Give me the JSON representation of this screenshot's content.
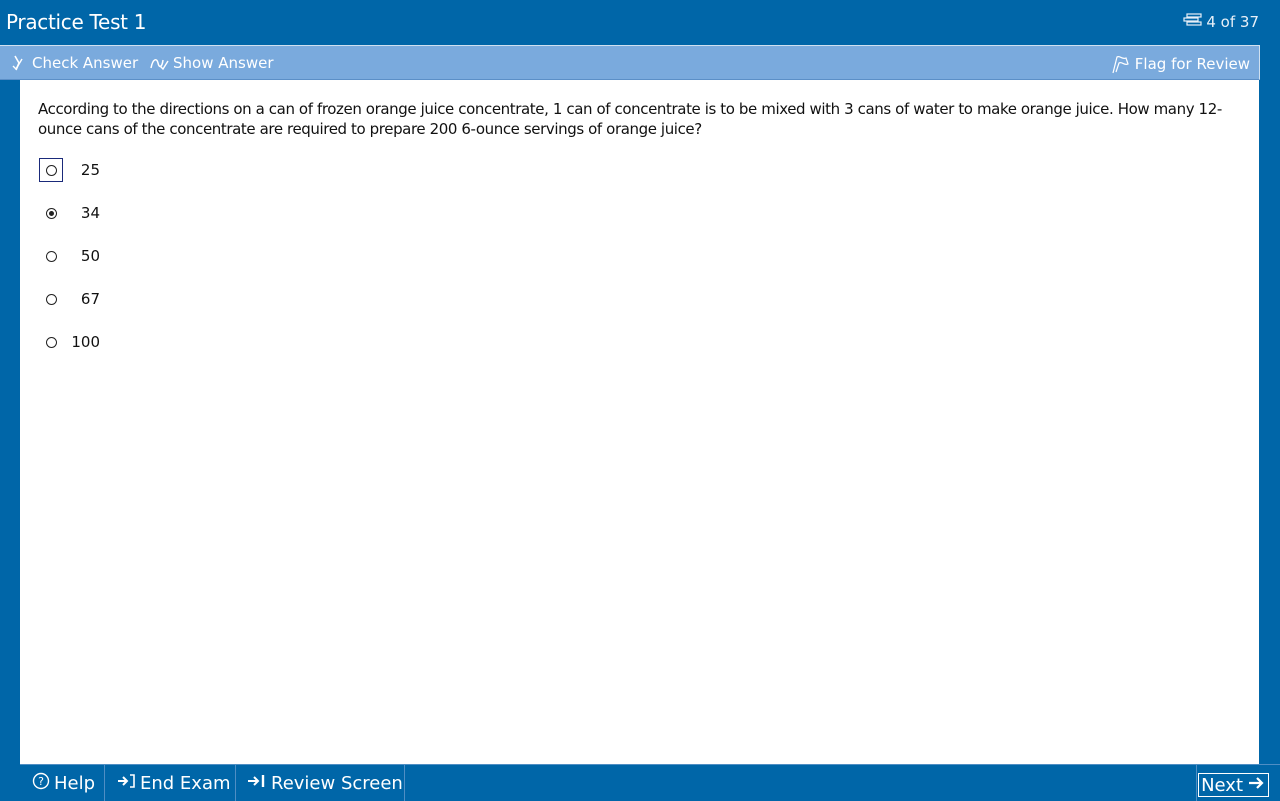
{
  "header": {
    "title": "Practice Test 1",
    "progress": "4 of 37"
  },
  "toolbar": {
    "check_answer": "Check Answer",
    "show_answer": "Show Answer",
    "flag_for_review": "Flag for Review"
  },
  "question": {
    "text": "According to the directions on a can of frozen orange juice concentrate, 1 can of concentrate is to be mixed with 3 cans of water to make orange juice.  How many 12-ounce cans of the concentrate are required to prepare 200 6-ounce servings of orange juice?",
    "choices": [
      {
        "label": "25",
        "selected": false,
        "focused": true
      },
      {
        "label": "34",
        "selected": true,
        "focused": false
      },
      {
        "label": "50",
        "selected": false,
        "focused": false
      },
      {
        "label": "67",
        "selected": false,
        "focused": false
      },
      {
        "label": "100",
        "selected": false,
        "focused": false
      }
    ]
  },
  "footer": {
    "help": "Help",
    "end_exam": "End Exam",
    "review_screen": "Review Screen",
    "next": "Next"
  },
  "colors": {
    "frame": "#0066a8",
    "toolbar": "#7aaadd",
    "content": "#ffffff"
  }
}
